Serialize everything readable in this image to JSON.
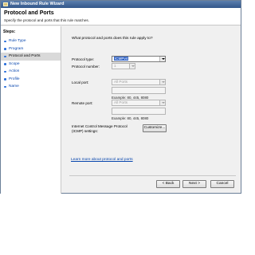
{
  "window": {
    "title": "New Inbound Rule Wizard"
  },
  "header": {
    "title": "Protocol and Ports",
    "subtitle": "Specify the protocol and ports that this rule matches."
  },
  "steps": {
    "heading": "Steps:",
    "items": [
      {
        "label": "Rule Type",
        "active": false
      },
      {
        "label": "Program",
        "active": false
      },
      {
        "label": "Protocol and Ports",
        "active": true
      },
      {
        "label": "Scope",
        "active": false
      },
      {
        "label": "Action",
        "active": false
      },
      {
        "label": "Profile",
        "active": false
      },
      {
        "label": "Name",
        "active": false
      }
    ]
  },
  "main": {
    "question": "What protocol and ports does this rule apply to?",
    "protocol_type_label": "Protocol type:",
    "protocol_type_value": "ICMPv4",
    "protocol_number_label": "Protocol number:",
    "protocol_number_value": "1",
    "local_port_label": "Local port:",
    "local_port_value": "All Ports",
    "local_example": "Example: 80, 445, 8080",
    "remote_port_label": "Remote port:",
    "remote_port_value": "All Ports",
    "remote_example": "Example: 80, 445, 8080",
    "icmp_label_line1": "Internet Control Message Protocol",
    "icmp_label_line2": "(ICMP) settings:",
    "customize_label": "Customize...",
    "learn_more_link": "Learn more about protocol and ports"
  },
  "footer": {
    "back_label": "< Back",
    "next_label": "Next >",
    "cancel_label": "Cancel"
  }
}
